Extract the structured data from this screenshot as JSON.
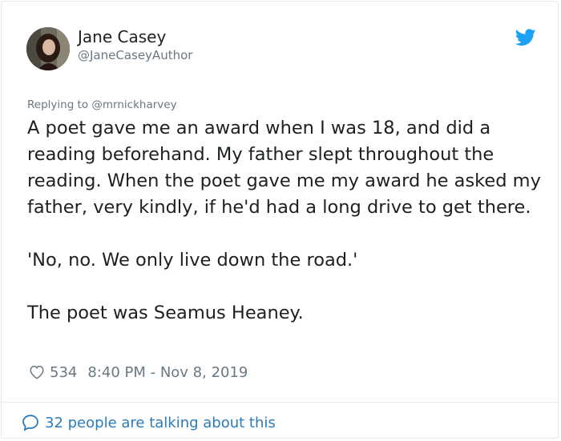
{
  "author": {
    "name": "Jane Casey",
    "handle": "@JaneCaseyAuthor"
  },
  "reply": {
    "prefix": "Replying to ",
    "mention": "@mrnickharvey"
  },
  "tweet": {
    "paragraphs": [
      "A poet gave me an award when I was 18, and did a reading beforehand. My father slept throughout the reading. When the poet gave me my award he asked my father, very kindly, if he'd had a long drive to get there.",
      "'No, no. We only live down the road.'",
      "The poet was Seamus Heaney."
    ]
  },
  "meta": {
    "likes": "534",
    "timestamp": "8:40 PM - Nov 8, 2019"
  },
  "footer": {
    "talking": "32 people are talking about this"
  },
  "icons": {
    "brand": "twitter-bird-icon",
    "like": "heart-icon",
    "conversation": "speech-bubble-icon"
  },
  "colors": {
    "brand": "#1da1f2",
    "link": "#2b7bb9",
    "muted": "#697882",
    "text": "#1c2022"
  }
}
